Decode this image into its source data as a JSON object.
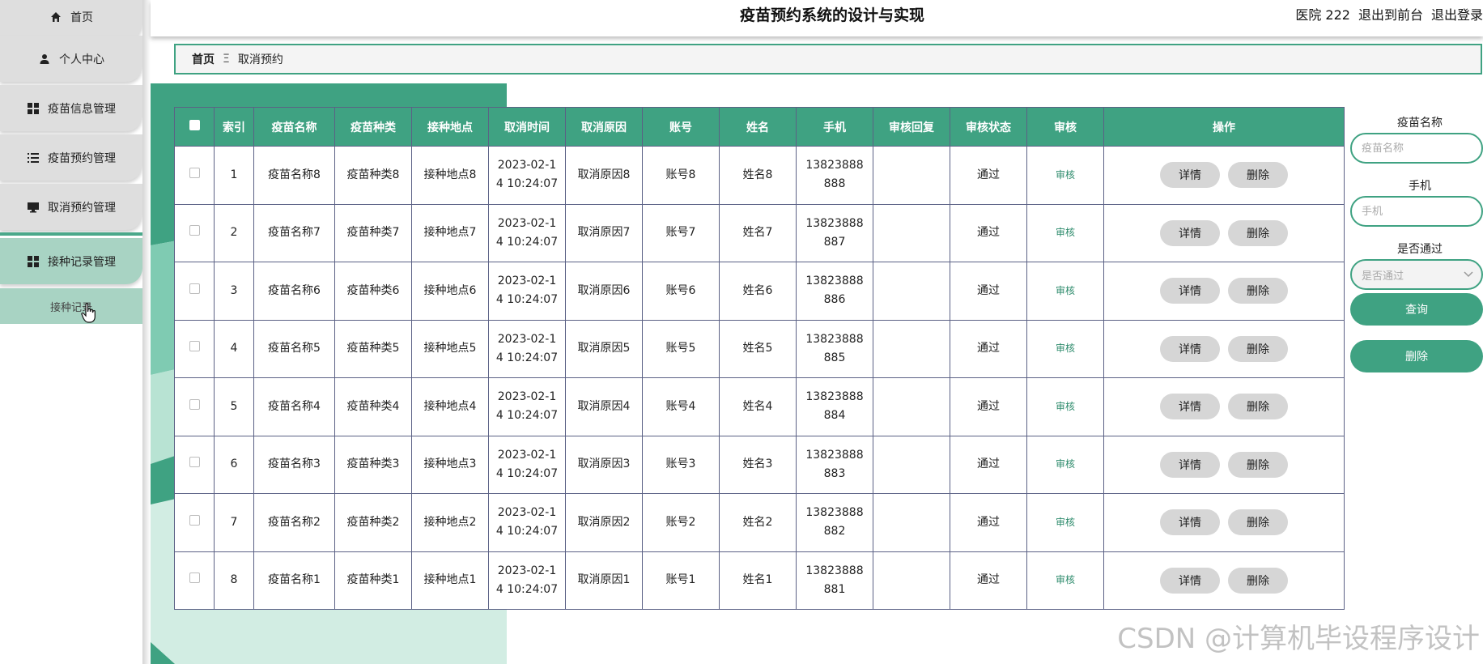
{
  "header": {
    "title": "疫苗预约系统的设计与实现",
    "user": "医院 222",
    "to_front": "退出到前台",
    "logout": "退出登录"
  },
  "sidebar": {
    "items": [
      {
        "label": "首页",
        "icon": "home-icon"
      },
      {
        "label": "个人中心",
        "icon": "user-icon"
      },
      {
        "label": "疫苗信息管理",
        "icon": "grid-icon"
      },
      {
        "label": "疫苗预约管理",
        "icon": "list-icon"
      },
      {
        "label": "取消预约管理",
        "icon": "monitor-icon"
      },
      {
        "label": "接种记录管理",
        "icon": "grid-icon"
      }
    ],
    "subitem": "接种记录"
  },
  "breadcrumb": {
    "home": "首页",
    "separator": "Ξ",
    "current": "取消预约"
  },
  "table": {
    "headers": [
      "索引",
      "疫苗名称",
      "疫苗种类",
      "接种地点",
      "取消时间",
      "取消原因",
      "账号",
      "姓名",
      "手机",
      "审核回复",
      "审核状态",
      "审核",
      "操作"
    ],
    "rows": [
      {
        "idx": "1",
        "name": "疫苗名称8",
        "type": "疫苗种类8",
        "place": "接种地点8",
        "time": "2023-02-14 10:24:07",
        "reason": "取消原因8",
        "account": "账号8",
        "person": "姓名8",
        "phone": "13823888888",
        "reply": "",
        "status": "通过",
        "audit": "审核"
      },
      {
        "idx": "2",
        "name": "疫苗名称7",
        "type": "疫苗种类7",
        "place": "接种地点7",
        "time": "2023-02-14 10:24:07",
        "reason": "取消原因7",
        "account": "账号7",
        "person": "姓名7",
        "phone": "13823888887",
        "reply": "",
        "status": "通过",
        "audit": "审核"
      },
      {
        "idx": "3",
        "name": "疫苗名称6",
        "type": "疫苗种类6",
        "place": "接种地点6",
        "time": "2023-02-14 10:24:07",
        "reason": "取消原因6",
        "account": "账号6",
        "person": "姓名6",
        "phone": "13823888886",
        "reply": "",
        "status": "通过",
        "audit": "审核"
      },
      {
        "idx": "4",
        "name": "疫苗名称5",
        "type": "疫苗种类5",
        "place": "接种地点5",
        "time": "2023-02-14 10:24:07",
        "reason": "取消原因5",
        "account": "账号5",
        "person": "姓名5",
        "phone": "13823888885",
        "reply": "",
        "status": "通过",
        "audit": "审核"
      },
      {
        "idx": "5",
        "name": "疫苗名称4",
        "type": "疫苗种类4",
        "place": "接种地点4",
        "time": "2023-02-14 10:24:07",
        "reason": "取消原因4",
        "account": "账号4",
        "person": "姓名4",
        "phone": "13823888884",
        "reply": "",
        "status": "通过",
        "audit": "审核"
      },
      {
        "idx": "6",
        "name": "疫苗名称3",
        "type": "疫苗种类3",
        "place": "接种地点3",
        "time": "2023-02-14 10:24:07",
        "reason": "取消原因3",
        "account": "账号3",
        "person": "姓名3",
        "phone": "13823888883",
        "reply": "",
        "status": "通过",
        "audit": "审核"
      },
      {
        "idx": "7",
        "name": "疫苗名称2",
        "type": "疫苗种类2",
        "place": "接种地点2",
        "time": "2023-02-14 10:24:07",
        "reason": "取消原因2",
        "account": "账号2",
        "person": "姓名2",
        "phone": "13823888882",
        "reply": "",
        "status": "通过",
        "audit": "审核"
      },
      {
        "idx": "8",
        "name": "疫苗名称1",
        "type": "疫苗种类1",
        "place": "接种地点1",
        "time": "2023-02-14 10:24:07",
        "reason": "取消原因1",
        "account": "账号1",
        "person": "姓名1",
        "phone": "13823888881",
        "reply": "",
        "status": "通过",
        "audit": "审核"
      }
    ],
    "detail_label": "详情",
    "delete_label": "删除"
  },
  "filter": {
    "name_label": "疫苗名称",
    "name_placeholder": "疫苗名称",
    "phone_label": "手机",
    "phone_placeholder": "手机",
    "pass_label": "是否通过",
    "pass_placeholder": "是否通过",
    "search_button": "查询",
    "delete_button": "删除"
  },
  "watermark": "CSDN @计算机毕设程序设计",
  "colors": {
    "accent": "#3fa282",
    "sidebar_active": "#a8d3c3",
    "button_gray": "#d6d6d6"
  }
}
